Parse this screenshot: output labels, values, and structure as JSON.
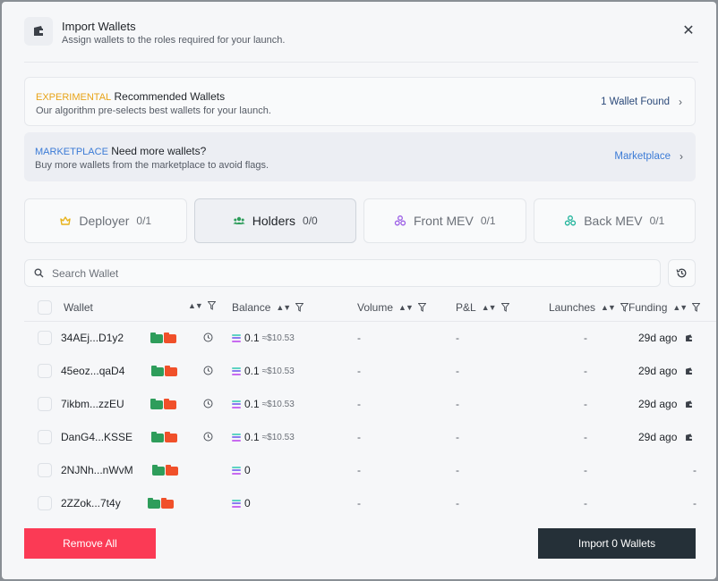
{
  "header": {
    "title": "Import Wallets",
    "subtitle": "Assign wallets to the roles required for your launch."
  },
  "recommended": {
    "tag": "EXPERIMENTAL",
    "title": "Recommended Wallets",
    "subtitle": "Our algorithm pre-selects best wallets for your launch.",
    "action": "1 Wallet Found"
  },
  "marketplace": {
    "tag": "MARKETPLACE",
    "title": "Need more wallets?",
    "subtitle": "Buy more wallets from the marketplace to avoid flags.",
    "action": "Marketplace"
  },
  "tabs": [
    {
      "label": "Deployer",
      "count": "0/1",
      "icon": "crown-icon",
      "color": "#e8b21a",
      "active": false
    },
    {
      "label": "Holders",
      "count": "0/0",
      "icon": "users-icon",
      "color": "#2e9d5b",
      "active": true
    },
    {
      "label": "Front MEV",
      "count": "0/1",
      "icon": "nodes-icon",
      "color": "#9b5de5",
      "active": false
    },
    {
      "label": "Back MEV",
      "count": "0/1",
      "icon": "nodes-icon",
      "color": "#1fb39a",
      "active": false
    }
  ],
  "search": {
    "placeholder": "Search Wallet",
    "value": ""
  },
  "table": {
    "columns": {
      "wallet": "Wallet",
      "balance": "Balance",
      "volume": "Volume",
      "pnl": "P&L",
      "launches": "Launches",
      "funding": "Funding"
    },
    "rows": [
      {
        "wallet": "34AEj...D1y2",
        "history": true,
        "balance": "0.1",
        "usd": "≈$10.53",
        "volume": "-",
        "pnl": "-",
        "launches": "-",
        "funding": "29d ago"
      },
      {
        "wallet": "45eoz...qaD4",
        "history": true,
        "balance": "0.1",
        "usd": "≈$10.53",
        "volume": "-",
        "pnl": "-",
        "launches": "-",
        "funding": "29d ago"
      },
      {
        "wallet": "7ikbm...zzEU",
        "history": true,
        "balance": "0.1",
        "usd": "≈$10.53",
        "volume": "-",
        "pnl": "-",
        "launches": "-",
        "funding": "29d ago"
      },
      {
        "wallet": "DanG4...KSSE",
        "history": true,
        "balance": "0.1",
        "usd": "≈$10.53",
        "volume": "-",
        "pnl": "-",
        "launches": "-",
        "funding": "29d ago"
      },
      {
        "wallet": "2NJNh...nWvM",
        "history": false,
        "balance": "0",
        "usd": "",
        "volume": "-",
        "pnl": "-",
        "launches": "-",
        "funding": "-"
      },
      {
        "wallet": "2ZZok...7t4y",
        "history": false,
        "balance": "0",
        "usd": "",
        "volume": "-",
        "pnl": "-",
        "launches": "-",
        "funding": "-"
      }
    ]
  },
  "footer": {
    "remove_label": "Remove All",
    "import_label": "Import 0 Wallets"
  },
  "colors": {
    "remove": "#fb3a55",
    "import": "#253038",
    "folder_green": "#2e9d5b",
    "folder_orange": "#f0502a",
    "experimental": "#e8a317",
    "marketplace": "#3b7bd6"
  }
}
